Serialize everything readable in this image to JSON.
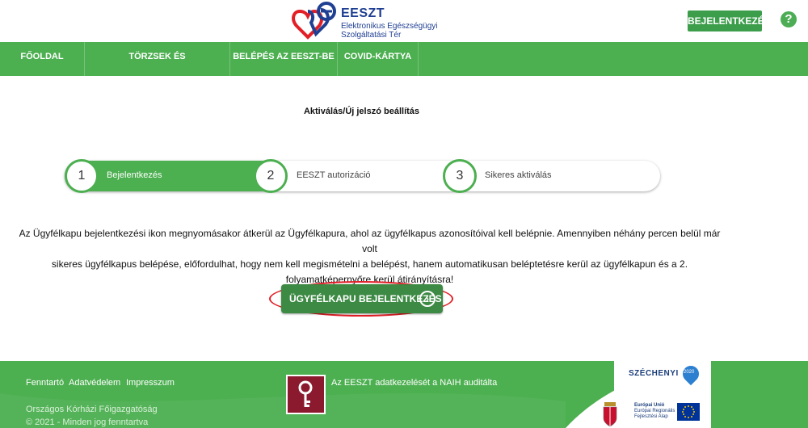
{
  "header": {
    "logo_title": "EESZT",
    "logo_sub_1": "Elektronikus Egészségügyi",
    "logo_sub_2": "Szolgáltatási Tér",
    "login_label": "BEJELENTKEZÉS",
    "help_label": "?"
  },
  "nav": {
    "items": [
      {
        "label": "FŐOLDAL"
      },
      {
        "label": "TÖRZSEK ÉS NYILVÁNTARTÁSOK"
      },
      {
        "label": "BELÉPÉS AZ EESZT-BE"
      },
      {
        "label": "COVID-KÁRTYA"
      }
    ]
  },
  "main": {
    "title": "Aktiválás/Új jelszó beállítás",
    "steps": [
      {
        "number": "1",
        "label": "Bejelentkezés",
        "active": true
      },
      {
        "number": "2",
        "label": "EESZT autorizáció",
        "active": false
      },
      {
        "number": "3",
        "label": "Sikeres aktiválás",
        "active": false
      }
    ],
    "info_line_1": "Az Ügyfélkapu bejelentkezési ikon megnyomásakor átkerül az Ügyfélkapura, ahol az ügyfélkapus azonosítóival kell belépnie. Amennyiben néhány percen belül már volt",
    "info_line_2": "sikeres ügyfélkapus belépése, előfordulhat, hogy nem kell megismételni a belépést, hanem automatikusan beléptetésre kerül az ügyfélkapun és a 2.",
    "info_line_3": "folyamatképernyőre kerül átirányításra!",
    "ugyfelkapu_label": "ÜGYFÉLKAPU BEJELENTKEZÉS",
    "ugyfelkapu_arrow": "›"
  },
  "footer": {
    "links": [
      {
        "label": "Fenntartó"
      },
      {
        "label": "Adatvédelem"
      },
      {
        "label": "Impresszum"
      }
    ],
    "naih_text": "Az EESZT adatkezelését a NAIH auditálta",
    "org_name": "Országos Kórházi Főigazgatóság",
    "copyright": "© 2021 - Minden jog fenntartva",
    "szechenyi": "SZÉCHENYI",
    "szechenyi_year": "2020",
    "eu_line_1": "Európai Unió",
    "eu_line_2": "Európai Regionális",
    "eu_line_3": "Fejlesztési Alap"
  },
  "colors": {
    "brand_green": "#4caf50",
    "dark_green": "#3d8a44",
    "brand_blue": "#1f3f92",
    "highlight_red": "#e21f26",
    "naih_maroon": "#8b1a2e"
  }
}
